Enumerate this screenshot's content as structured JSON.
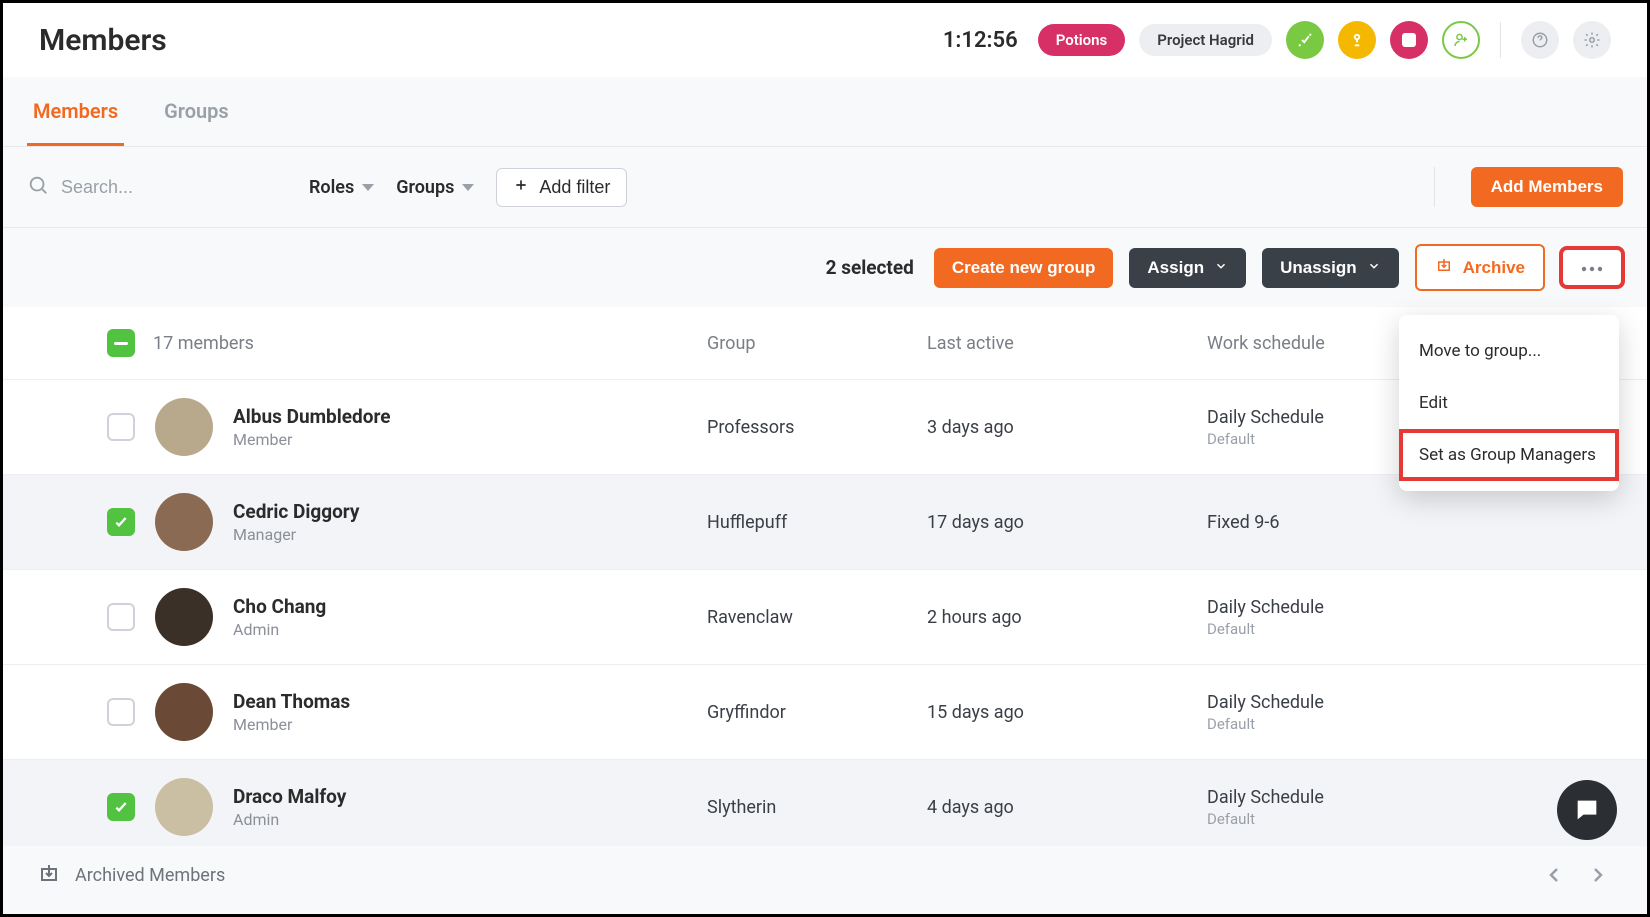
{
  "header": {
    "title": "Members",
    "timer": "1:12:56",
    "badge1": "Potions",
    "badge2": "Project Hagrid"
  },
  "tabs": {
    "items": [
      {
        "label": "Members",
        "active": true
      },
      {
        "label": "Groups",
        "active": false
      }
    ]
  },
  "toolbar": {
    "search_placeholder": "Search...",
    "roles_label": "Roles",
    "groups_label": "Groups",
    "add_filter_label": "Add filter",
    "add_members_label": "Add Members"
  },
  "actionbar": {
    "selected_text": "2 selected",
    "create_group": "Create new group",
    "assign": "Assign",
    "unassign": "Unassign",
    "archive": "Archive"
  },
  "table": {
    "count_label": "17 members",
    "headers": {
      "group": "Group",
      "last_active": "Last active",
      "schedule": "Work schedule"
    },
    "rows": [
      {
        "name": "Albus Dumbledore",
        "role": "Member",
        "group": "Professors",
        "last_active": "3 days ago",
        "schedule": "Daily Schedule",
        "schedule_sub": "Default",
        "selected": false,
        "avatar_bg": "#b8a98c"
      },
      {
        "name": "Cedric Diggory",
        "role": "Manager",
        "group": "Hufflepuff",
        "last_active": "17 days ago",
        "schedule": "Fixed 9-6",
        "schedule_sub": "",
        "selected": true,
        "avatar_bg": "#8a6a52"
      },
      {
        "name": "Cho Chang",
        "role": "Admin",
        "group": "Ravenclaw",
        "last_active": "2 hours ago",
        "schedule": "Daily Schedule",
        "schedule_sub": "Default",
        "selected": false,
        "avatar_bg": "#3b3028"
      },
      {
        "name": "Dean Thomas",
        "role": "Member",
        "group": "Gryffindor",
        "last_active": "15 days ago",
        "schedule": "Daily Schedule",
        "schedule_sub": "Default",
        "selected": false,
        "avatar_bg": "#6a4a36"
      },
      {
        "name": "Draco Malfoy",
        "role": "Admin",
        "group": "Slytherin",
        "last_active": "4 days ago",
        "schedule": "Daily Schedule",
        "schedule_sub": "Default",
        "selected": true,
        "avatar_bg": "#cbbfa3"
      }
    ]
  },
  "dropdown": {
    "items": [
      {
        "label": "Move to group...",
        "highlight": false
      },
      {
        "label": "Edit",
        "highlight": false
      },
      {
        "label": "Set as Group Managers",
        "highlight": true
      }
    ]
  },
  "footer": {
    "archived_label": "Archived Members"
  },
  "colors": {
    "accent": "#f26a21",
    "pink": "#d73067",
    "green": "#52c241",
    "highlight": "#e53935"
  }
}
